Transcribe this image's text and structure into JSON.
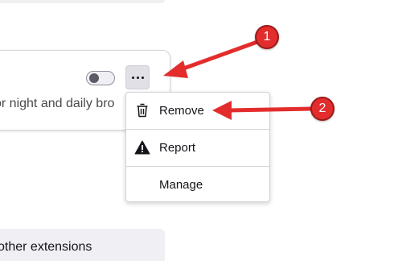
{
  "extension_card": {
    "description": "or night and daily bro",
    "toggle_state": "off",
    "more_button_label": "More options"
  },
  "context_menu": {
    "items": [
      {
        "label": "Remove",
        "icon": "trash-icon"
      },
      {
        "label": "Report",
        "icon": "warning-icon"
      },
      {
        "label": "Manage",
        "icon": ""
      }
    ]
  },
  "footer": {
    "text": "other extensions"
  },
  "annotations": {
    "badge_1": "1",
    "badge_2": "2",
    "color": "#e32d2d"
  }
}
